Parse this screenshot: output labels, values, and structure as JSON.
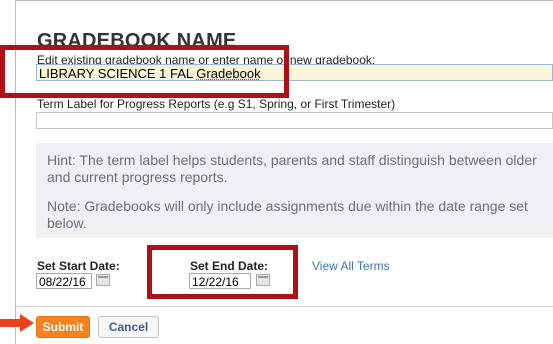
{
  "form": {
    "title": "GRADEBOOK NAME",
    "name_description": "Edit existing gradebook name or enter name of new gradebook:",
    "name_value_part1": "LIBRARY SCIENCE 1 FAL",
    "name_value_part2": "Gradebook",
    "term_label": "Term Label for Progress Reports (e.g S1, Spring, or First Trimester)",
    "term_value": "",
    "hint_1": "Hint: The term label helps students, parents and staff distinguish between older and current progress reports.",
    "hint_2": "Note: Gradebooks will only include assignments due within the date range set below.",
    "start_label": "Set Start Date:",
    "start_value": "08/22/16",
    "end_label": "Set End Date:",
    "end_value": "12/22/16",
    "view_all_terms": "View All Terms"
  },
  "actions": {
    "submit": "Submit",
    "cancel": "Cancel"
  },
  "annotation": {
    "highlight_color": "#b00f16",
    "arrow_color": "#e8411b"
  },
  "colors": {
    "submit_bg": "#f5821f",
    "link": "#3a73b4"
  }
}
